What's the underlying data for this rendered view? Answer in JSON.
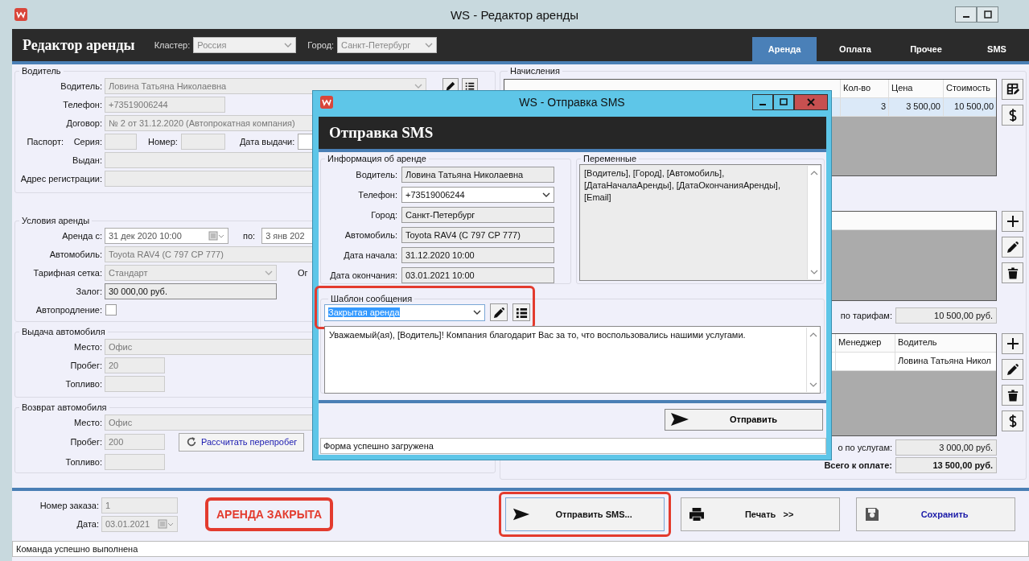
{
  "window": {
    "title": "WS - Редактор аренды"
  },
  "header": {
    "title": "Редактор аренды",
    "cluster_label": "Кластер:",
    "cluster": "Россия",
    "city_label": "Город:",
    "city": "Санкт-Петербург"
  },
  "tabs": [
    {
      "label": "Аренда",
      "selected": true
    },
    {
      "label": "Оплата",
      "selected": false
    },
    {
      "label": "Прочее",
      "selected": false
    },
    {
      "label": "SMS",
      "selected": false
    }
  ],
  "driver_group": {
    "title": "Водитель",
    "driver_label": "Водитель:",
    "driver": "Ловина Татьяна Николаевна",
    "phone_label": "Телефон:",
    "phone": "+73519006244",
    "contract_label": "Договор:",
    "contract": "№ 2 от 31.12.2020 (Автопрокатная компания)",
    "passport_label": "Паспорт:",
    "series_label": "Серия:",
    "number_label": "Номер:",
    "issue_date_label": "Дата выдачи:",
    "issued_by_label": "Выдан:",
    "address_label": "Адрес регистрации:"
  },
  "rental_group": {
    "title": "Условия аренды",
    "from_label": "Аренда с:",
    "from": "31 дек 2020  10:00",
    "to_label": "по:",
    "to": "3 янв 202",
    "car_label": "Автомобиль:",
    "car": "Toyota RAV4 (С 797 СР 777)",
    "tariff_label": "Тарифная сетка:",
    "tariff": "Стандарт",
    "cut_label": "Ог",
    "deposit_label": "Залог:",
    "deposit": "30 000,00 руб.",
    "autorenew_label": "Автопродление:",
    "autorenew": false
  },
  "issue_group": {
    "title": "Выдача автомобиля",
    "place_label": "Место:",
    "place": "Офис",
    "mileage_label": "Пробег:",
    "mileage": "20",
    "fuel_label": "Топливо:"
  },
  "return_group": {
    "title": "Возврат автомобиля",
    "place_label": "Место:",
    "place": "Офис",
    "mileage_label": "Пробег:",
    "mileage": "200",
    "fuel_label": "Топливо:",
    "recalc_button": "Рассчитать перепробег"
  },
  "charges": {
    "title": "Начисления",
    "columns": [
      "Кол-во",
      "Цена",
      "Стоимость"
    ],
    "rows": [
      {
        "cells": [
          "3",
          "3 500,00",
          "10 500,00"
        ],
        "selected": true
      }
    ]
  },
  "tariff_total": {
    "label": "по тарифам:",
    "value": "10 500,00 руб."
  },
  "services": {
    "columns": [
      "Менеджер",
      "Водитель"
    ],
    "rows": [
      {
        "driver": "Ловина Татьяна Никол"
      }
    ]
  },
  "services_total": {
    "label": "о по услугам:",
    "value": "3 000,00 руб."
  },
  "grand_total": {
    "label": "Всего к оплате:",
    "value": "13 500,00 руб."
  },
  "footer": {
    "order_label": "Номер заказа:",
    "order": "1",
    "date_label": "Дата:",
    "date": "03.01.2021",
    "status_badge": "АРЕНДА ЗАКРЫТА",
    "buttons": [
      {
        "label": "Отправить SMS...",
        "kind": "send",
        "highlighted": true
      },
      {
        "label": "Печать   >>",
        "kind": "print",
        "highlighted": false
      },
      {
        "label": "Сохранить",
        "kind": "save",
        "highlighted": false
      }
    ]
  },
  "status_bar": "Команда успешно выполнена",
  "dialog": {
    "title": "WS - Отправка SMS",
    "heading": "Отправка SMS",
    "info_title": "Информация об аренде",
    "fields": [
      {
        "label": "Водитель:",
        "value": "Ловина Татьяна Николаевна",
        "kind": "text"
      },
      {
        "label": "Телефон:",
        "value": "+73519006244",
        "kind": "select"
      },
      {
        "label": "Город:",
        "value": "Санкт-Петербург",
        "kind": "text"
      },
      {
        "label": "Автомобиль:",
        "value": "Toyota RAV4 (С 797 СР 777)",
        "kind": "text"
      },
      {
        "label": "Дата начала:",
        "value": "31.12.2020 10:00",
        "kind": "text"
      },
      {
        "label": "Дата окончания:",
        "value": "03.01.2021 10:00",
        "kind": "text"
      }
    ],
    "variables_title": "Переменные",
    "variables": "[Водитель], [Город], [Автомобиль], [ДатаНачалаАренды], [ДатаОкончанияАренды], [Email]",
    "template_title": "Шаблон сообщения",
    "template": "Закрытая аренда",
    "template_highlighted": true,
    "message": "Уважаемый(ая), [Водитель]! Компания благодарит Вас за то, что воспользовались нашими услугами.",
    "send_button": "Отправить",
    "status": "Форма успешно загружена"
  }
}
